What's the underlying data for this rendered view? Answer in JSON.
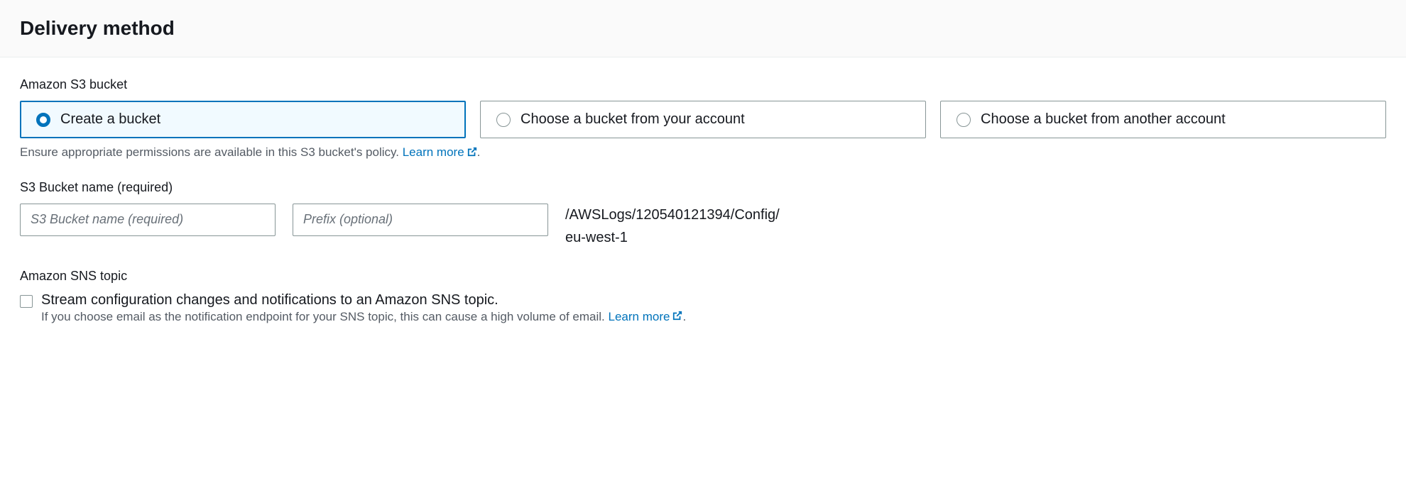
{
  "header": {
    "title": "Delivery method"
  },
  "s3": {
    "section_label": "Amazon S3 bucket",
    "options": {
      "create": "Create a bucket",
      "choose_own": "Choose a bucket from your account",
      "choose_other": "Choose a bucket from another account"
    },
    "helper_text": "Ensure appropriate permissions are available in this S3 bucket's policy. ",
    "learn_more": "Learn more",
    "bucket_name_label": "S3 Bucket name (required)",
    "bucket_name_placeholder": "S3 Bucket name (required)",
    "prefix_placeholder": "Prefix (optional)",
    "path_line1": "/AWSLogs/120540121394/Config/",
    "path_line2": "eu-west-1"
  },
  "sns": {
    "section_label": "Amazon SNS topic",
    "checkbox_label": "Stream configuration changes and notifications to an Amazon SNS topic.",
    "helper_text": "If you choose email as the notification endpoint for your SNS topic, this can cause a high volume of email. ",
    "learn_more": "Learn more"
  }
}
